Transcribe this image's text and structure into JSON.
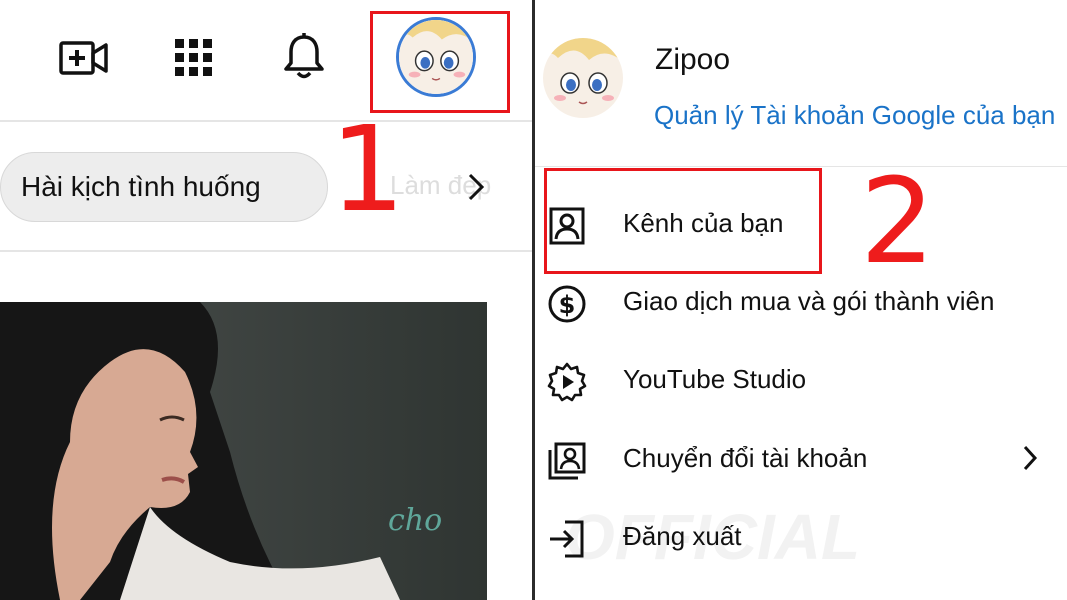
{
  "left": {
    "toolbar": {
      "create_icon": "video-add-icon",
      "apps_icon": "apps-grid-icon",
      "notification_icon": "bell-icon",
      "avatar_icon": "avatar-icon"
    },
    "chip_label": "Hài kịch tình huống",
    "next_chip_label": "Làm đẹp",
    "step_marker": "1",
    "thumbnail_caption": "cho"
  },
  "right": {
    "account": {
      "name": "Zipoo",
      "manage_link": "Quản lý Tài khoản Google của bạn"
    },
    "step_marker": "2",
    "menu": [
      {
        "label": "Kênh của bạn",
        "icon": "person-icon"
      },
      {
        "label": "Giao dịch mua và gói thành viên",
        "icon": "dollar-icon"
      },
      {
        "label": "YouTube Studio",
        "icon": "studio-gear-icon"
      },
      {
        "label": "Chuyển đổi tài khoản",
        "icon": "switch-account-icon"
      },
      {
        "label": "Đăng xuất",
        "icon": "sign-out-icon"
      }
    ],
    "background_watermark": "OFFICIAL"
  },
  "colors": {
    "highlight": "#e8161b",
    "link": "#1a73c8"
  }
}
